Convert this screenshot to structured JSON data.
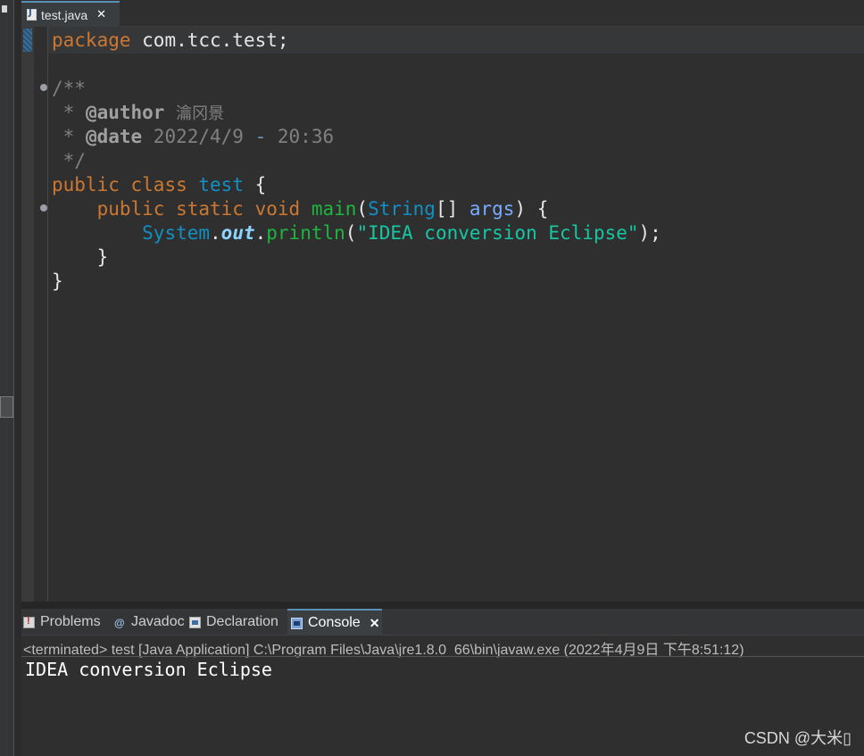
{
  "editor_tab": {
    "label": "test.java",
    "close": "✕"
  },
  "code": {
    "line1": {
      "kw": "package",
      "rest": " com.tcc.test;"
    },
    "line3": "/**",
    "line4": {
      "star": " * ",
      "tag": "@author",
      "name": "瀹冈景"
    },
    "line5": {
      "star": " * ",
      "tag": "@date",
      "date": " 2022/4/9 ",
      "dash": "-",
      "time": " 20:36"
    },
    "line6": " */",
    "line7": {
      "kw1": "public",
      "kw2": "class",
      "cls": "test",
      "brace": " {"
    },
    "line8": {
      "kw1": "public",
      "kw2": "static",
      "kw3": "void",
      "method": "main",
      "open": "(",
      "type": "String",
      "arr": "[] ",
      "param": "args",
      "close": ") {"
    },
    "line9": {
      "cls": "System",
      "dot1": ".",
      "field": "out",
      "dot2": ".",
      "method": "println",
      "open": "(",
      "str": "\"IDEA conversion Eclipse\"",
      "close": ");"
    },
    "line10": "}",
    "line11": "}"
  },
  "panel": {
    "tabs": [
      {
        "label": "Problems",
        "icon": "problems-icon"
      },
      {
        "label": "Javadoc",
        "icon": "javadoc-icon"
      },
      {
        "label": "Declaration",
        "icon": "declaration-icon"
      },
      {
        "label": "Console",
        "icon": "console-icon",
        "close": "✕"
      }
    ]
  },
  "console": {
    "status": "<terminated> test [Java Application] C:\\Program Files\\Java\\jre1.8.0_66\\bin\\javaw.exe (2022年4月9日 下午8:51:12)",
    "output": "IDEA conversion Eclipse"
  },
  "watermark": "CSDN @大米▯"
}
